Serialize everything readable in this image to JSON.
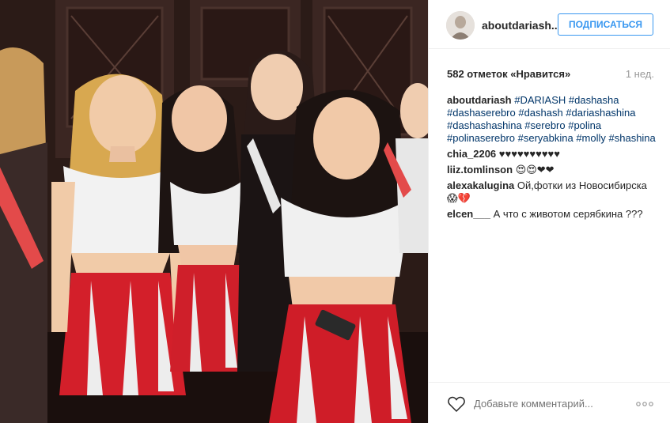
{
  "post": {
    "photo_alt": "Photo of young women in white tops and red skirts",
    "username": "aboutdariash...",
    "follow_label": "ПОДПИСАТЬСЯ",
    "likes": "582 отметок «Нравится»",
    "time": "1 нед.",
    "caption": {
      "user": "aboutdariash",
      "text": "#DARIASH #dashasha #dashaserebro #dashash #dariashashina #dashashashina #serebro #polina #polinaserebro #seryabkina #molly #shashina"
    },
    "comments": [
      {
        "user": "chia_2206",
        "text": "♥♥♥♥♥♥♥♥♥♥"
      },
      {
        "user": "liiz.tomlinson",
        "text": "😍😍❤❤"
      },
      {
        "user": "alexakalugina",
        "text": "Ой,фотки из Новосибирска 😱💔"
      },
      {
        "user": "elcen___",
        "text": "А что с животом серябкина ???"
      }
    ],
    "add_comment_placeholder": "Добавьте комментарий...",
    "icons": {
      "like": "heart-outline-icon",
      "options": "more-dots-icon"
    }
  }
}
